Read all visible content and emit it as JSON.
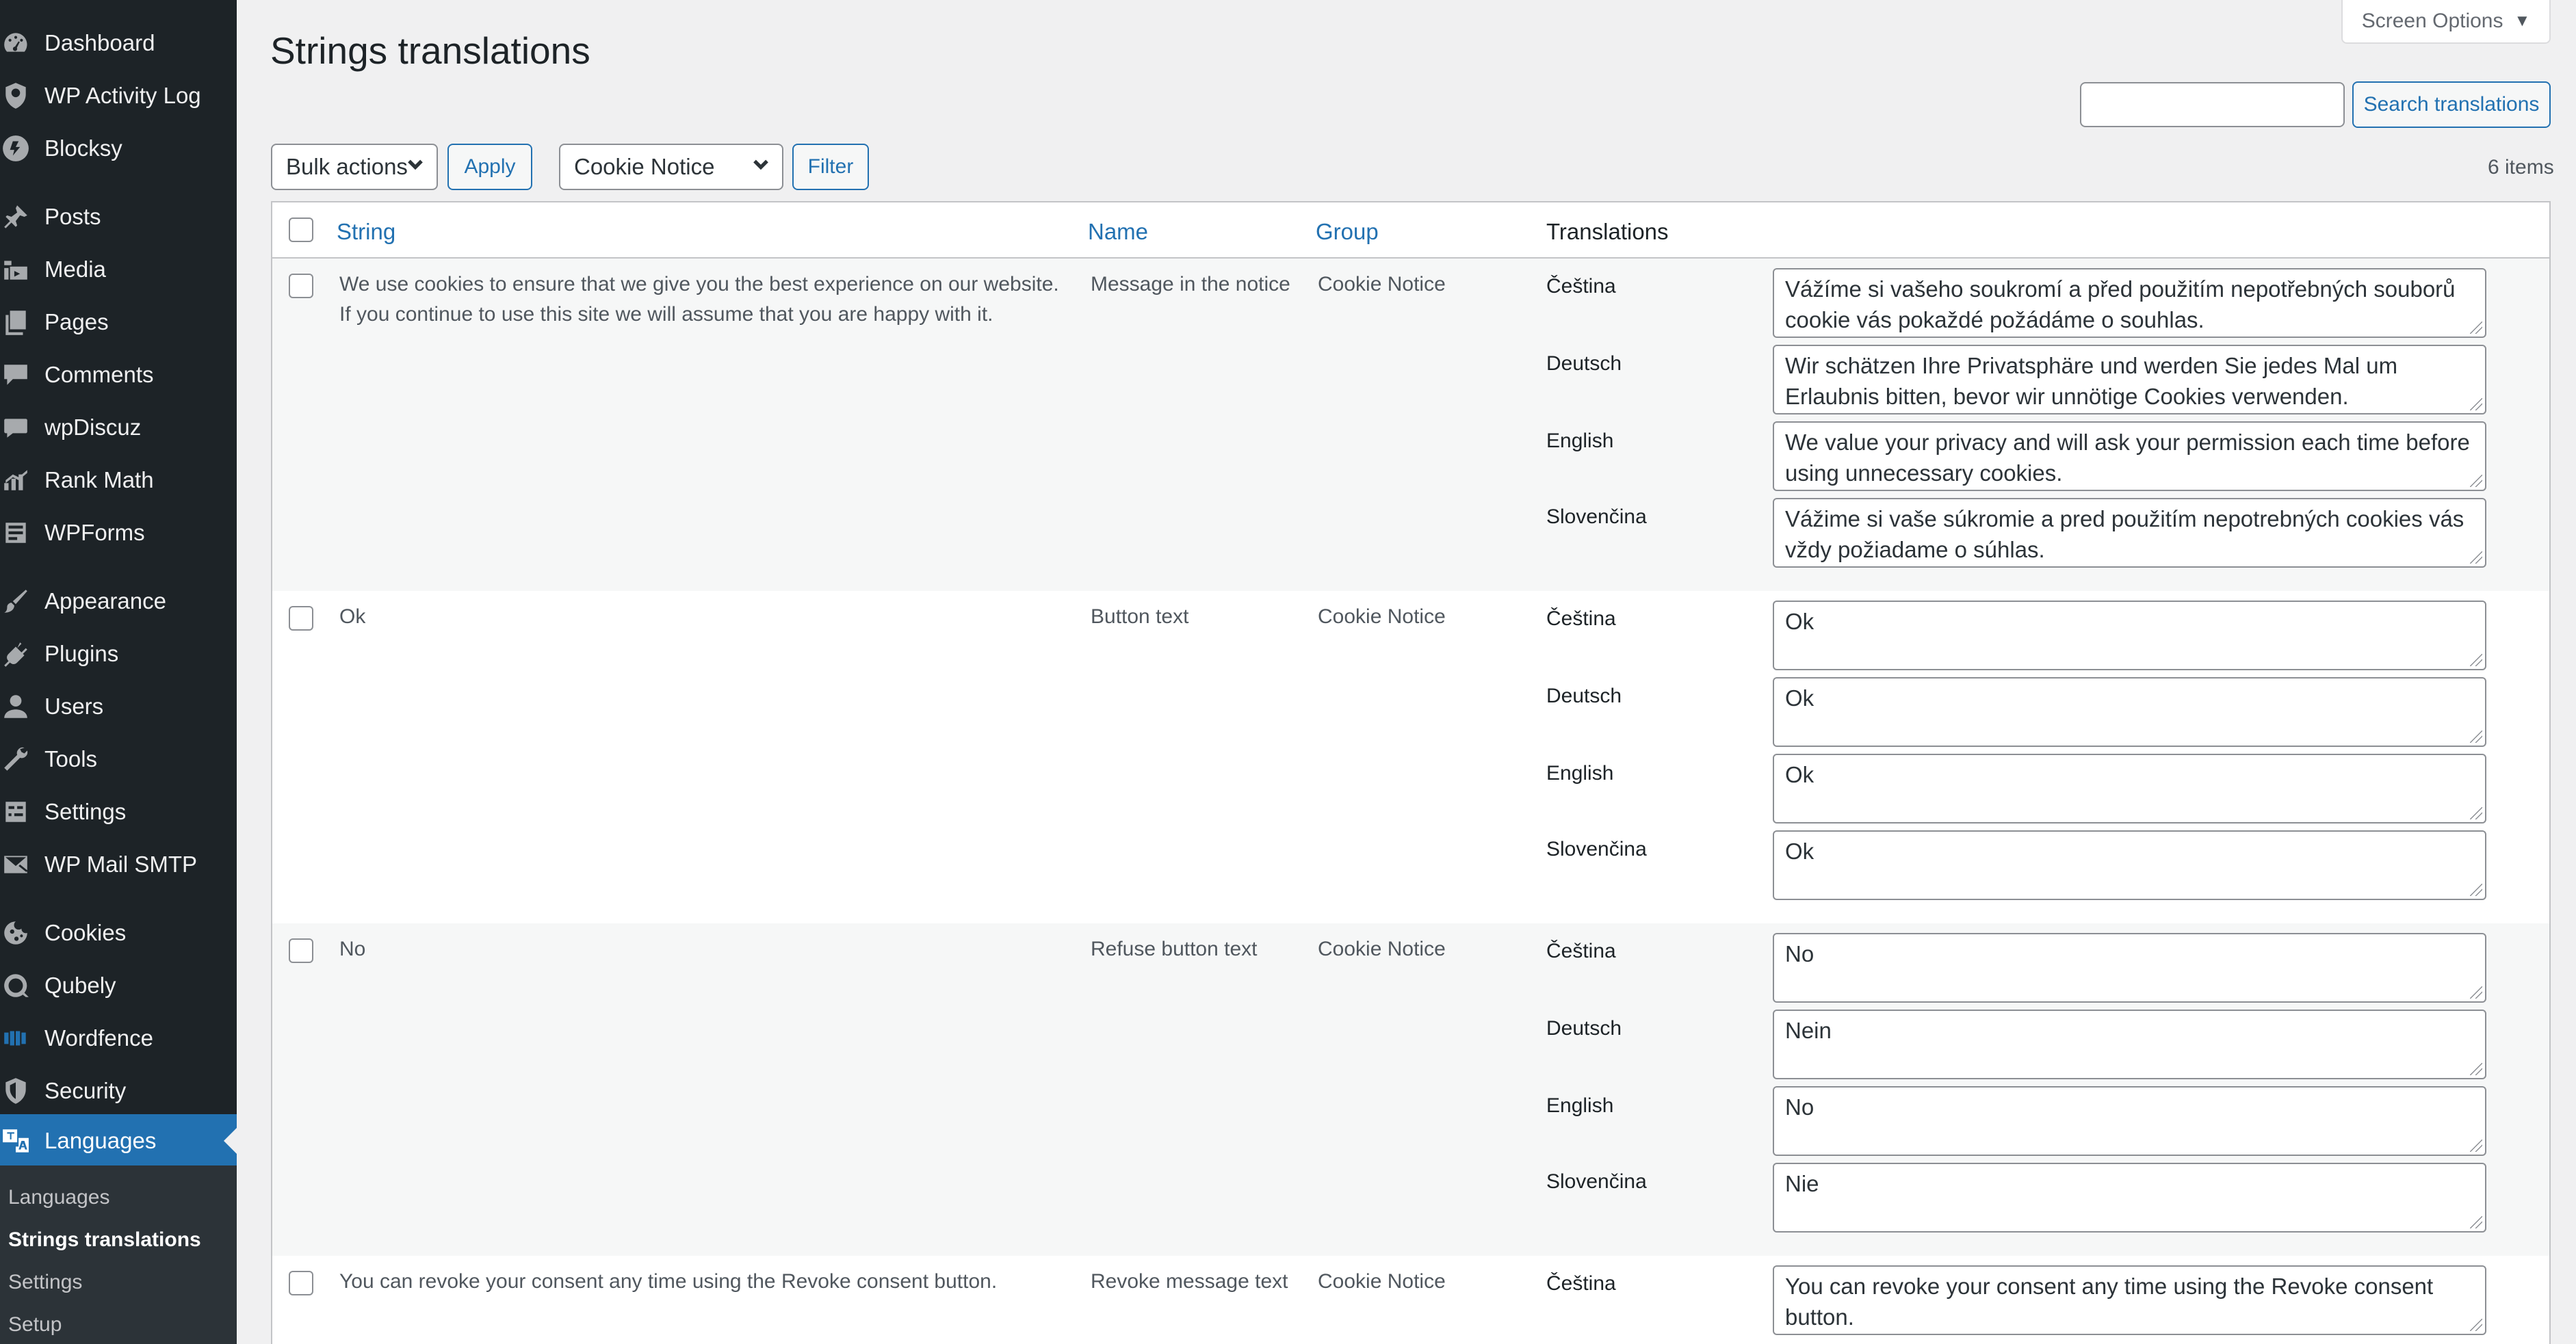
{
  "sidebar": {
    "items": [
      {
        "label": "Dashboard",
        "icon": "dashboard-icon"
      },
      {
        "label": "WP Activity Log",
        "icon": "shield-icon"
      },
      {
        "label": "Blocksy",
        "icon": "blocksy-icon"
      },
      {
        "label": "Posts",
        "icon": "pin-icon"
      },
      {
        "label": "Media",
        "icon": "media-icon"
      },
      {
        "label": "Pages",
        "icon": "pages-icon"
      },
      {
        "label": "Comments",
        "icon": "comment-icon"
      },
      {
        "label": "wpDiscuz",
        "icon": "discuz-icon"
      },
      {
        "label": "Rank Math",
        "icon": "chart-icon"
      },
      {
        "label": "WPForms",
        "icon": "forms-icon"
      },
      {
        "label": "Appearance",
        "icon": "brush-icon"
      },
      {
        "label": "Plugins",
        "icon": "plug-icon"
      },
      {
        "label": "Users",
        "icon": "user-icon"
      },
      {
        "label": "Tools",
        "icon": "wrench-icon"
      },
      {
        "label": "Settings",
        "icon": "sliders-icon"
      },
      {
        "label": "WP Mail SMTP",
        "icon": "mail-icon"
      },
      {
        "label": "Cookies",
        "icon": "cookie-icon"
      },
      {
        "label": "Qubely",
        "icon": "q-icon"
      },
      {
        "label": "Wordfence",
        "icon": "wordfence-icon"
      },
      {
        "label": "Security",
        "icon": "security-icon"
      },
      {
        "label": "Languages",
        "icon": "translate-icon"
      }
    ],
    "submenu": [
      "Languages",
      "Strings translations",
      "Settings",
      "Setup"
    ]
  },
  "header": {
    "title": "Strings translations",
    "screen_options": "Screen Options"
  },
  "search": {
    "value": "",
    "button": "Search translations"
  },
  "toolbar": {
    "bulk_actions": "Bulk actions",
    "apply": "Apply",
    "group_filter": "Cookie Notice",
    "filter": "Filter",
    "items_count": "6 items"
  },
  "table": {
    "columns": {
      "string": "String",
      "name": "Name",
      "group": "Group",
      "translations": "Translations"
    },
    "rows": [
      {
        "string": "We use cookies to ensure that we give you the best experience on our website. If you continue to use this site we will assume that you are happy with it.",
        "name": "Message in the notice",
        "group": "Cookie Notice",
        "translations": [
          {
            "lang": "Čeština",
            "value": "Vážíme si vašeho soukromí a před použitím nepotřebných souborů cookie vás pokaždé požádáme o souhlas."
          },
          {
            "lang": "Deutsch",
            "value": "Wir schätzen Ihre Privatsphäre und werden Sie jedes Mal um Erlaubnis bitten, bevor wir unnötige Cookies verwenden."
          },
          {
            "lang": "English",
            "value": "We value your privacy and will ask your permission each time before using unnecessary cookies."
          },
          {
            "lang": "Slovenčina",
            "value": "Vážime si vaše súkromie a pred použitím nepotrebných cookies vás vždy požiadame o súhlas."
          }
        ]
      },
      {
        "string": "Ok",
        "name": "Button text",
        "group": "Cookie Notice",
        "translations": [
          {
            "lang": "Čeština",
            "value": "Ok"
          },
          {
            "lang": "Deutsch",
            "value": "Ok"
          },
          {
            "lang": "English",
            "value": "Ok"
          },
          {
            "lang": "Slovenčina",
            "value": "Ok"
          }
        ]
      },
      {
        "string": "No",
        "name": "Refuse button text",
        "group": "Cookie Notice",
        "translations": [
          {
            "lang": "Čeština",
            "value": "No"
          },
          {
            "lang": "Deutsch",
            "value": "Nein"
          },
          {
            "lang": "English",
            "value": "No"
          },
          {
            "lang": "Slovenčina",
            "value": "Nie"
          }
        ]
      },
      {
        "string": "You can revoke your consent any time using the Revoke consent button.",
        "name": "Revoke message text",
        "group": "Cookie Notice",
        "translations": [
          {
            "lang": "Čeština",
            "value": "You can revoke your consent any time using the Revoke consent button."
          }
        ]
      }
    ]
  },
  "colors": {
    "sidebar_bg": "#1d2327",
    "accent": "#2271b1",
    "page_bg": "#f0f0f1"
  }
}
